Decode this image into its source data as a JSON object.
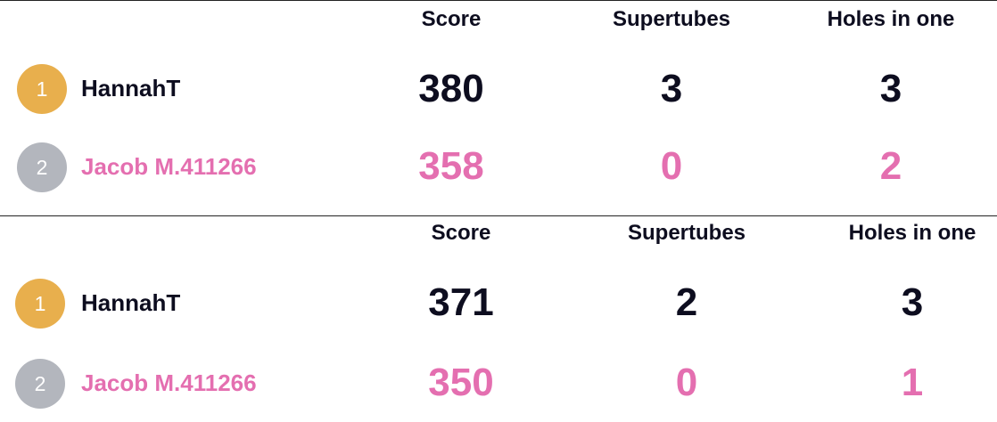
{
  "boards": [
    {
      "headers": {
        "score": "Score",
        "supertubes": "Supertubes",
        "holes": "Holes in one"
      },
      "rows": [
        {
          "rank": "1",
          "name": "HannahT",
          "score": "380",
          "supertubes": "3",
          "holes": "3"
        },
        {
          "rank": "2",
          "name": "Jacob M.411266",
          "score": "358",
          "supertubes": "0",
          "holes": "2"
        }
      ]
    },
    {
      "headers": {
        "score": "Score",
        "supertubes": "Supertubes",
        "holes": "Holes in one"
      },
      "rows": [
        {
          "rank": "1",
          "name": "HannahT",
          "score": "371",
          "supertubes": "2",
          "holes": "3"
        },
        {
          "rank": "2",
          "name": "Jacob M.411266",
          "score": "350",
          "supertubes": "0",
          "holes": "1"
        }
      ]
    }
  ],
  "colors": {
    "text_dark": "#0d0d1f",
    "highlight_pink": "#e46fb0",
    "rank1_gold": "#e8af4d",
    "rank2_silver": "#b3b6bd"
  }
}
